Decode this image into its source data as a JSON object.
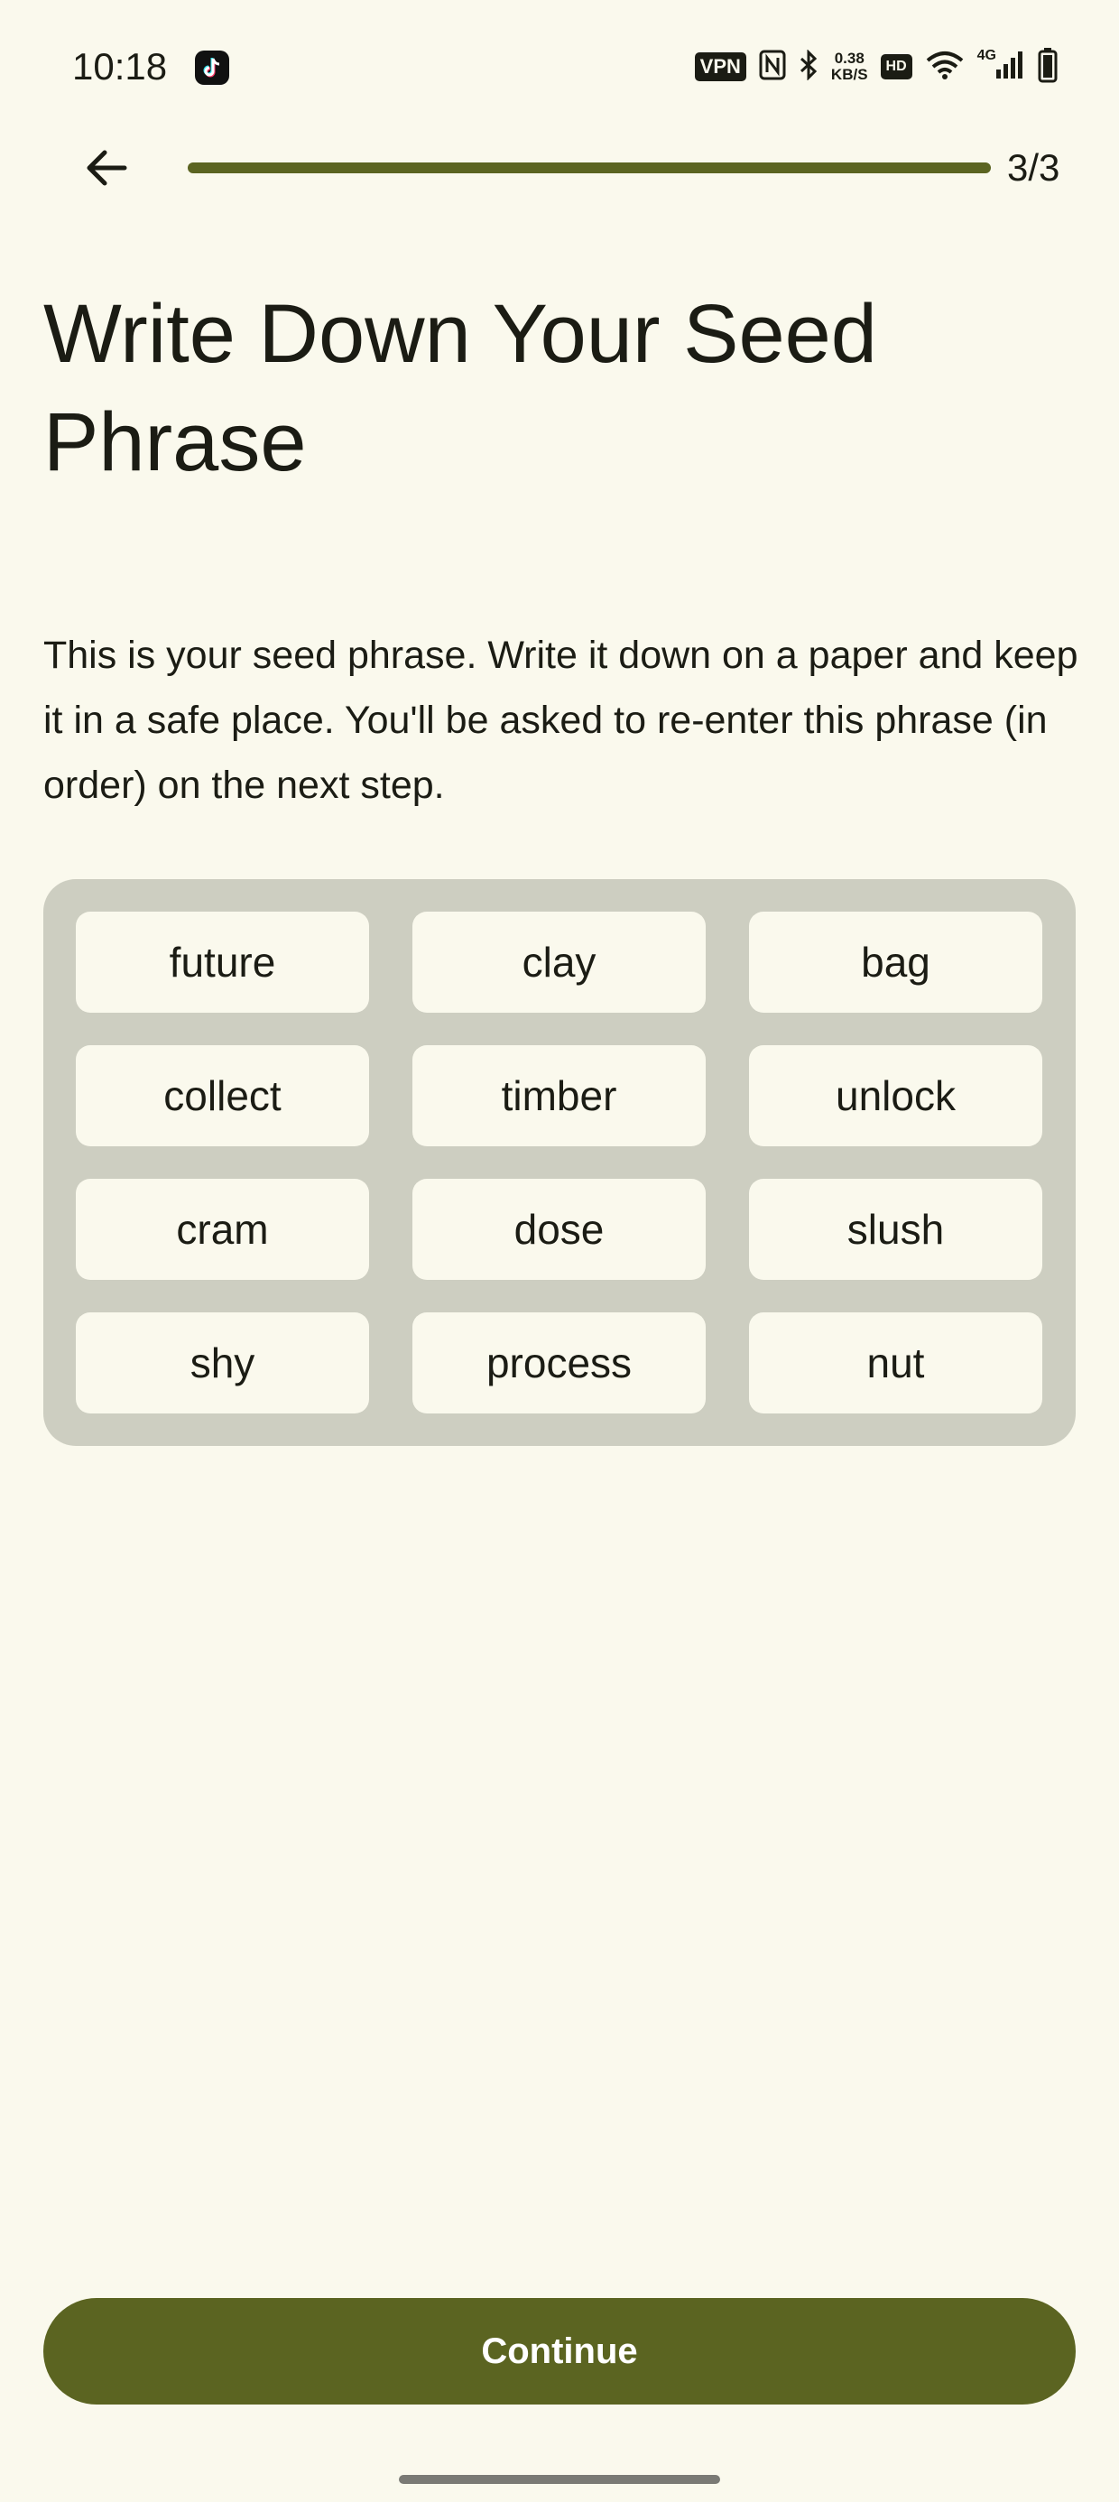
{
  "status_bar": {
    "time": "10:18",
    "vpn": "VPN",
    "speed_value": "0.38",
    "speed_unit": "KB/S",
    "hd": "HD",
    "network": "4G"
  },
  "header": {
    "step_counter": "3/3",
    "progress_fraction": 1.0
  },
  "title": "Write Down Your Seed Phrase",
  "description": "This is your seed phrase. Write it down on a paper and keep it in a safe place. You'll be asked to re-enter this phrase (in order) on the next step.",
  "seed_words": [
    "future",
    "clay",
    "bag",
    "collect",
    "timber",
    "unlock",
    "cram",
    "dose",
    "slush",
    "shy",
    "process",
    "nut"
  ],
  "continue_label": "Continue",
  "colors": {
    "background": "#FAF9ED",
    "accent": "#5B6421",
    "card": "#CDCEC1"
  },
  "icons": {
    "back": "arrow-back-icon",
    "app": "tiktok-icon",
    "nfc": "nfc-icon",
    "bluetooth": "bluetooth-icon",
    "wifi": "wifi-icon",
    "signal": "signal-icon",
    "battery": "battery-icon"
  }
}
